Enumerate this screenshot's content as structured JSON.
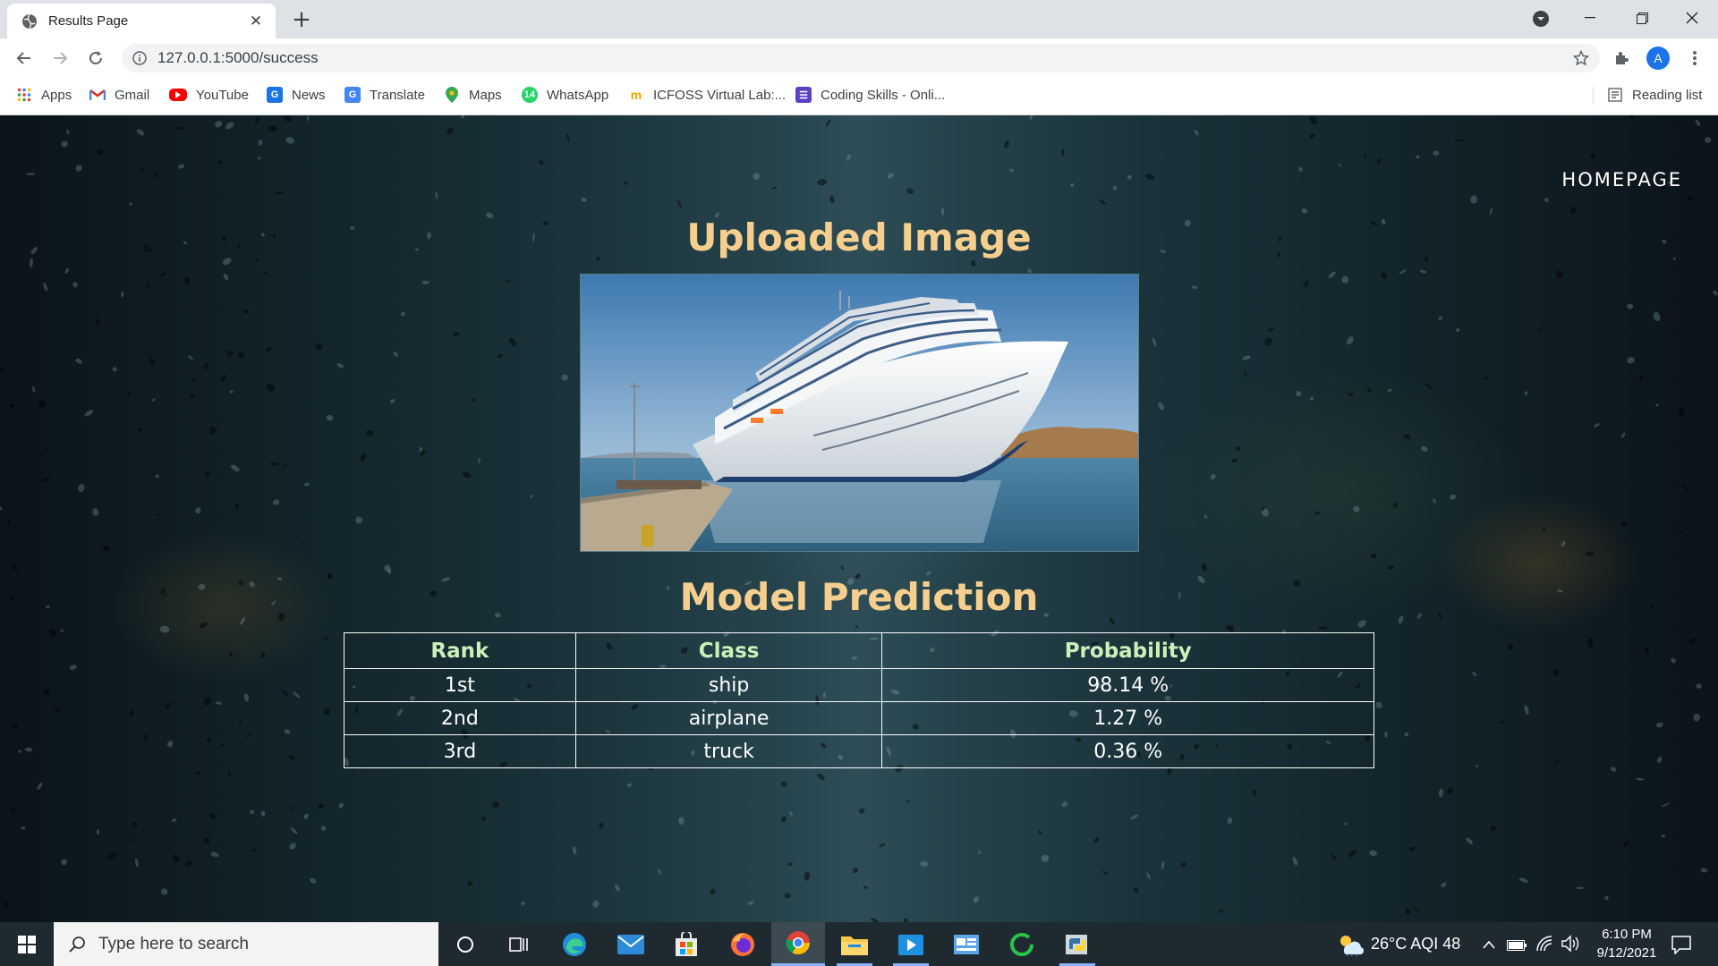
{
  "browser": {
    "tab_title": "Results Page",
    "url": "127.0.0.1:5000/success",
    "profile_initial": "A",
    "reading_list": "Reading list"
  },
  "bookmarks": [
    {
      "label": "Apps",
      "icon": "apps-grid-icon"
    },
    {
      "label": "Gmail",
      "icon": "gmail-icon",
      "color": "#d93025"
    },
    {
      "label": "YouTube",
      "icon": "youtube-icon",
      "color": "#ff0000"
    },
    {
      "label": "News",
      "icon": "google-news-icon",
      "color": "#1a73e8"
    },
    {
      "label": "Translate",
      "icon": "translate-icon",
      "color": "#4285f4"
    },
    {
      "label": "Maps",
      "icon": "maps-pin-icon",
      "color": "#34a853"
    },
    {
      "label": "WhatsApp",
      "icon": "whatsapp-icon",
      "color": "#25d366"
    },
    {
      "label": "ICFOSS Virtual Lab:...",
      "icon": "icfoss-icon",
      "color": "#f4a100"
    },
    {
      "label": "Coding Skills - Onli...",
      "icon": "coding-skills-icon",
      "color": "#5b3fc4"
    }
  ],
  "page": {
    "homepage_link": "HOMEPAGE",
    "uploaded_heading": "Uploaded Image",
    "prediction_heading": "Model Prediction",
    "table": {
      "headers": [
        "Rank",
        "Class",
        "Probability"
      ],
      "rows": [
        [
          "1st",
          "ship",
          "98.14 %"
        ],
        [
          "2nd",
          "airplane",
          "1.27 %"
        ],
        [
          "3rd",
          "truck",
          "0.36 %"
        ]
      ]
    }
  },
  "taskbar": {
    "search_placeholder": "Type here to search",
    "weather": "26°C  AQI 48",
    "time": "6:10 PM",
    "date": "9/12/2021"
  },
  "colors": {
    "heading": "#f6cf8e",
    "table_header": "#cdf0b8",
    "accent": "#1a73e8"
  }
}
